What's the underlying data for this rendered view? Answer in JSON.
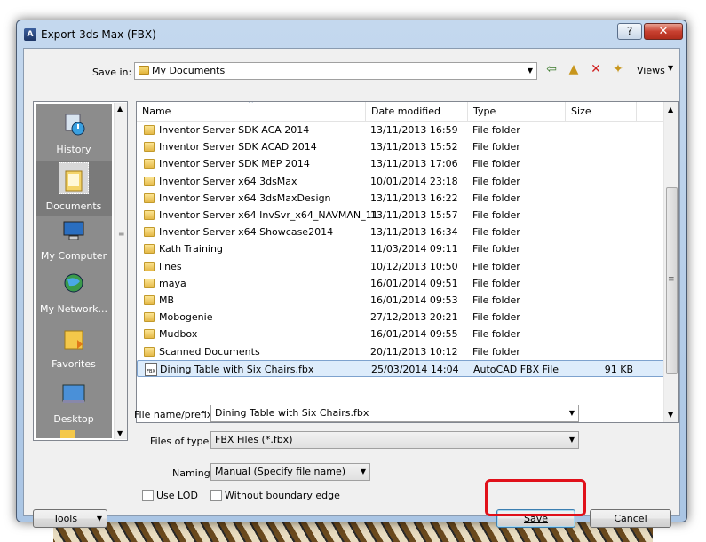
{
  "window": {
    "title": "Export 3ds Max (FBX)",
    "help_label": "?",
    "close_label": "✕"
  },
  "save_in": {
    "label": "Save in:",
    "value": "My Documents",
    "views_label": "Views"
  },
  "places": [
    {
      "label": "History",
      "icon": "history-icon"
    },
    {
      "label": "Documents",
      "icon": "documents-icon",
      "selected": true
    },
    {
      "label": "My Computer",
      "icon": "computer-icon"
    },
    {
      "label": "My Network...",
      "icon": "network-icon"
    },
    {
      "label": "Favorites",
      "icon": "favorites-icon"
    },
    {
      "label": "Desktop",
      "icon": "desktop-icon"
    }
  ],
  "columns": [
    "Name",
    "Date modified",
    "Type",
    "Size"
  ],
  "files": [
    {
      "name": "Inventor Server SDK ACA 2014",
      "date": "13/11/2013 16:59",
      "type": "File folder",
      "size": ""
    },
    {
      "name": "Inventor Server SDK ACAD 2014",
      "date": "13/11/2013 15:52",
      "type": "File folder",
      "size": ""
    },
    {
      "name": "Inventor Server SDK MEP 2014",
      "date": "13/11/2013 17:06",
      "type": "File folder",
      "size": ""
    },
    {
      "name": "Inventor Server x64 3dsMax",
      "date": "10/01/2014 23:18",
      "type": "File folder",
      "size": ""
    },
    {
      "name": "Inventor Server x64 3dsMaxDesign",
      "date": "13/11/2013 16:22",
      "type": "File folder",
      "size": ""
    },
    {
      "name": "Inventor Server x64 InvSvr_x64_NAVMAN_11",
      "date": "13/11/2013 15:57",
      "type": "File folder",
      "size": ""
    },
    {
      "name": "Inventor Server x64 Showcase2014",
      "date": "13/11/2013 16:34",
      "type": "File folder",
      "size": ""
    },
    {
      "name": "Kath Training",
      "date": "11/03/2014 09:11",
      "type": "File folder",
      "size": ""
    },
    {
      "name": "lines",
      "date": "10/12/2013 10:50",
      "type": "File folder",
      "size": ""
    },
    {
      "name": "maya",
      "date": "16/01/2014 09:51",
      "type": "File folder",
      "size": ""
    },
    {
      "name": "MB",
      "date": "16/01/2014 09:53",
      "type": "File folder",
      "size": ""
    },
    {
      "name": "Mobogenie",
      "date": "27/12/2013 20:21",
      "type": "File folder",
      "size": ""
    },
    {
      "name": "Mudbox",
      "date": "16/01/2014 09:55",
      "type": "File folder",
      "size": ""
    },
    {
      "name": "Scanned Documents",
      "date": "20/11/2013 10:12",
      "type": "File folder",
      "size": ""
    },
    {
      "name": "Dining Table with Six Chairs.fbx",
      "date": "25/03/2014 14:04",
      "type": "AutoCAD FBX File",
      "size": "91 KB",
      "fbx": true,
      "selected": true
    }
  ],
  "filename": {
    "label": "File name/prefix:",
    "value": "Dining Table with Six Chairs.fbx"
  },
  "filetype": {
    "label": "Files of type:",
    "value": "FBX Files  (*.fbx)"
  },
  "naming": {
    "label": "Naming:",
    "value": "Manual (Specify file name)"
  },
  "options": {
    "use_lod": "Use LOD",
    "without_boundary": "Without boundary edge"
  },
  "buttons": {
    "tools": "Tools",
    "save": "Save",
    "cancel": "Cancel"
  },
  "fbx_badge": "FBX",
  "accent": {
    "highlight": "#e0101a",
    "selection": "#ddecfb"
  }
}
